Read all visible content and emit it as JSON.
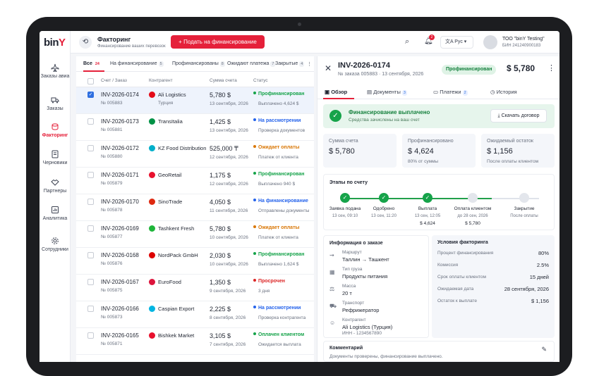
{
  "brand": {
    "logo_main": "bin",
    "logo_accent": "Y"
  },
  "sidebar": {
    "items": [
      {
        "label": "Заказы авиа",
        "icon": "plane-icon"
      },
      {
        "label": "Заказы",
        "icon": "truck-icon"
      },
      {
        "label": "Факторинг",
        "icon": "coins-icon"
      },
      {
        "label": "Черновики",
        "icon": "draft-icon"
      },
      {
        "label": "Партнеры",
        "icon": "handshake-icon"
      },
      {
        "label": "Аналитика",
        "icon": "chart-icon"
      },
      {
        "label": "Сотрудники",
        "icon": "gear-icon"
      }
    ]
  },
  "header": {
    "title": "Факторинг",
    "subtitle": "Финансирование ваших перевозок",
    "apply_label": "Подать на финансирование",
    "notif_count": "2",
    "lang": "Рус",
    "company": "ТОО \"binY Testing\"",
    "bin": "БИН 241240900183"
  },
  "list": {
    "tabs": [
      {
        "label": "Все",
        "count": "24"
      },
      {
        "label": "На финансирование",
        "count": "5"
      },
      {
        "label": "Профинансированы",
        "count": "8"
      },
      {
        "label": "Ожидают платежа",
        "count": "7"
      },
      {
        "label": "Закрытые",
        "count": "4"
      }
    ],
    "columns": [
      "Счет / Заказ",
      "Контрагент",
      "Сумма счета",
      "Статус"
    ],
    "rows": [
      {
        "inv": "INV-2026-0174",
        "ord": "№ 005883",
        "name": "Ali Logistics",
        "country": "Турция",
        "amount": "5,780 $",
        "date": "13 сентября, 2026",
        "status": "Профинансирован",
        "status_color": "#16a34a",
        "detail": "Выплачено 4,624 $",
        "flag": "#e30a17",
        "selected": true
      },
      {
        "inv": "INV-2026-0173",
        "ord": "№ 005881",
        "name": "TransItalia",
        "country": "",
        "amount": "1,425 $",
        "date": "13 сентября, 2026",
        "status": "На рассмотрении",
        "status_color": "#2563eb",
        "detail": "Проверка документов",
        "flag": "#009246",
        "selected": false
      },
      {
        "inv": "INV-2026-0172",
        "ord": "№ 005880",
        "name": "KZ Food Distribution",
        "country": "",
        "amount": "525,000 ₸",
        "date": "12 сентября, 2026",
        "status": "Ожидает оплаты",
        "status_color": "#d97706",
        "detail": "Платеж от клиента",
        "flag": "#00afca",
        "selected": false
      },
      {
        "inv": "INV-2026-0171",
        "ord": "№ 005879",
        "name": "GeoRetail",
        "country": "",
        "amount": "1,175 $",
        "date": "12 сентября, 2026",
        "status": "Профинансирован",
        "status_color": "#16a34a",
        "detail": "Выплачено 940 $",
        "flag": "#e8112d",
        "selected": false
      },
      {
        "inv": "INV-2026-0170",
        "ord": "№ 005878",
        "name": "SinoTrade",
        "country": "",
        "amount": "4,050 $",
        "date": "11 сентября, 2026",
        "status": "На финансирование",
        "status_color": "#2563eb",
        "detail": "Отправлены документы",
        "flag": "#de2910",
        "selected": false
      },
      {
        "inv": "INV-2026-0169",
        "ord": "№ 005877",
        "name": "Tashkent Fresh",
        "country": "",
        "amount": "5,780 $",
        "date": "10 сентября, 2026",
        "status": "Ожидает оплаты",
        "status_color": "#d97706",
        "detail": "Платеж от клиента",
        "flag": "#1eb53a",
        "selected": false
      },
      {
        "inv": "INV-2026-0168",
        "ord": "№ 005876",
        "name": "NordPack GmbH",
        "country": "",
        "amount": "2,030 $",
        "date": "10 сентября, 2026",
        "status": "Профинансирован",
        "status_color": "#16a34a",
        "detail": "Выплачено 1,624 $",
        "flag": "#dd0000",
        "selected": false
      },
      {
        "inv": "INV-2026-0167",
        "ord": "№ 005875",
        "name": "EuroFood",
        "country": "",
        "amount": "1,350 $",
        "date": "9 сентября, 2026",
        "status": "Просрочен",
        "status_color": "#dc2626",
        "detail": "3 дня",
        "flag": "#dc143c",
        "selected": false
      },
      {
        "inv": "INV-2026-0166",
        "ord": "№ 005873",
        "name": "Caspian Export",
        "country": "",
        "amount": "2,225 $",
        "date": "8 сентября, 2026",
        "status": "На рассмотрении",
        "status_color": "#2563eb",
        "detail": "Проверка контрагента",
        "flag": "#00b5e2",
        "selected": false
      },
      {
        "inv": "INV-2026-0165",
        "ord": "№ 005871",
        "name": "Bishkek Market",
        "country": "",
        "amount": "3,105 $",
        "date": "7 сентября, 2026",
        "status": "Оплачен клиентом",
        "status_color": "#16a34a",
        "detail": "Ожидается выплата",
        "flag": "#e8112d",
        "selected": false
      }
    ]
  },
  "detail": {
    "inv": "INV-2026-0174",
    "sub": "№ заказа 005883 · 13 сентября, 2026",
    "badge": "Профинансирован",
    "amount": "$ 5,780",
    "tabs": [
      {
        "label": "Обзор",
        "count": ""
      },
      {
        "label": "Документы",
        "count": "3"
      },
      {
        "label": "Платежи",
        "count": "2"
      },
      {
        "label": "История",
        "count": ""
      }
    ],
    "banner": {
      "title": "Финансирование выплачено",
      "sub": "Средства зачислены на ваш счет",
      "download": "Скачать договор"
    },
    "cards": [
      {
        "label": "Сумма счета",
        "value": "$ 5,780",
        "sub": ""
      },
      {
        "label": "Профинансировано",
        "value": "$ 4,624",
        "sub": "80% от суммы"
      },
      {
        "label": "Ожидаемый остаток",
        "value": "$ 1,156",
        "sub": "После оплаты клиентом"
      }
    ],
    "stages_title": "Этапы по счету",
    "stages": [
      {
        "label": "Заявка подана",
        "date": "13 сен, 09:10",
        "amount": "",
        "done": true
      },
      {
        "label": "Одобрено",
        "date": "13 сен, 11:20",
        "amount": "",
        "done": true
      },
      {
        "label": "Выплата",
        "date": "13 сен, 12:05",
        "amount": "$ 4,624",
        "done": true
      },
      {
        "label": "Оплата клиентом",
        "date": "до 28 сен, 2026",
        "amount": "$ 5,780",
        "done": false
      },
      {
        "label": "Закрытие",
        "date": "После оплаты",
        "amount": "",
        "done": false
      }
    ],
    "info_title": "Информация о заказе",
    "info": [
      {
        "label": "Маршрут",
        "value": "Таллин → Ташкент",
        "icon": "route-icon"
      },
      {
        "label": "Тип груза",
        "value": "Продукты питания",
        "icon": "box-icon"
      },
      {
        "label": "Масса",
        "value": "20 т",
        "icon": "weight-icon"
      },
      {
        "label": "Транспорт",
        "value": "Рефрижератор",
        "icon": "truck-icon"
      },
      {
        "label": "Контрагент",
        "value": "Ali Logistics (Турция)",
        "value2": "ИНН - 1234567890",
        "icon": "person-icon"
      }
    ],
    "cond_title": "Условия факторинга",
    "conditions": [
      {
        "label": "Процент финансирования",
        "value": "80%"
      },
      {
        "label": "Комиссия",
        "value": "2.5%"
      },
      {
        "label": "Срок оплаты клиентом",
        "value": "15 дней"
      },
      {
        "label": "Ожидаемая дата",
        "value": "28 сентября, 2026"
      },
      {
        "label": "Остаток к выплате",
        "value": "$ 1,156"
      }
    ],
    "comment_title": "Комментарий",
    "comment_text": "Документы проверены, финансирование выплачено."
  }
}
